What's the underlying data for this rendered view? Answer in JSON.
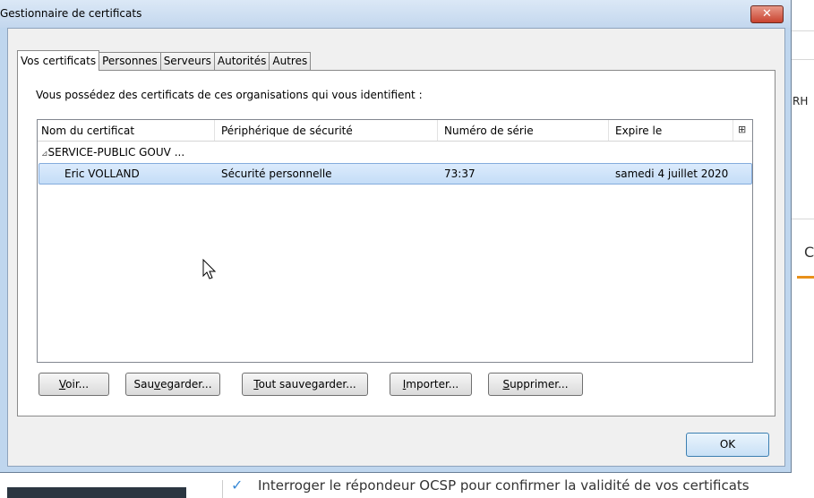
{
  "window": {
    "title": "Gestionnaire de certificats",
    "close_label": "x"
  },
  "tabs": [
    {
      "label": "Vos certificats",
      "active": true
    },
    {
      "label": "Personnes",
      "active": false
    },
    {
      "label": "Serveurs",
      "active": false
    },
    {
      "label": "Autorités",
      "active": false
    },
    {
      "label": "Autres",
      "active": false
    }
  ],
  "panel": {
    "intro": "Vous possédez des certificats de ces organisations qui vous identifient :"
  },
  "table": {
    "columns": [
      "Nom du certificat",
      "Périphérique de sécurité",
      "Numéro de série",
      "Expire le"
    ],
    "group": {
      "toggle": "⊿",
      "name": "SERVICE-PUBLIC GOUV ..."
    },
    "rows": [
      {
        "name": "Eric VOLLAND",
        "device": "Sécurité personnelle",
        "serial": "73:37",
        "expires": "samedi 4 juillet 2020"
      }
    ],
    "column_picker_icon": "column-picker-icon"
  },
  "buttons": {
    "view": {
      "mnemonic": "V",
      "rest": "oir..."
    },
    "backup": {
      "pre": "Sau",
      "mnemonic": "v",
      "post": "egarder..."
    },
    "backup_all": {
      "mnemonic": "T",
      "rest": "out sauvegarder..."
    },
    "import": {
      "mnemonic": "I",
      "rest": "mporter..."
    },
    "delete": {
      "mnemonic": "S",
      "rest": "upprimer..."
    },
    "ok": "OK"
  },
  "background": {
    "right_label": "RH",
    "right_letter": "C",
    "bottom_text": "Interroger le répondeur OCSP pour confirmer la validité de vos certificats",
    "check_icon": "check-icon"
  },
  "colors": {
    "selection": "#cfe4fa",
    "title_bar": "#c9dcf1",
    "accent_orange": "#e8901a"
  }
}
